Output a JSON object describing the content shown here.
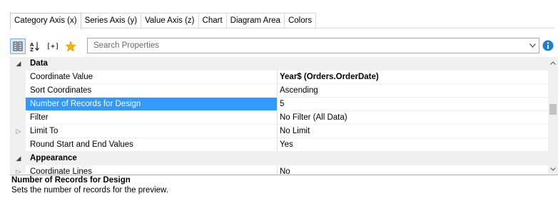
{
  "tabs": [
    {
      "label": "Category Axis (x)",
      "active": true
    },
    {
      "label": "Series Axis (y)",
      "active": false
    },
    {
      "label": "Value Axis (z)",
      "active": false
    },
    {
      "label": "Chart",
      "active": false
    },
    {
      "label": "Diagram Area",
      "active": false
    },
    {
      "label": "Colors",
      "active": false
    }
  ],
  "toolbar": {
    "categorized_icon": "categorized-icon",
    "sort_icon": "sort-az-icon",
    "expand_label": "[+]",
    "favorites_icon": "star-icon",
    "search_placeholder": "Search Properties",
    "info_icon": "info-icon"
  },
  "grid": {
    "rows": [
      {
        "type": "category",
        "name": "Data",
        "expander": "◢"
      },
      {
        "type": "property",
        "name": "Coordinate Value",
        "value": "Year$ (Orders.OrderDate)",
        "bold_value": true
      },
      {
        "type": "property",
        "name": "Sort Coordinates",
        "value": "Ascending"
      },
      {
        "type": "property",
        "name": "Number of Records for Design",
        "value": "5",
        "selected": true
      },
      {
        "type": "property",
        "name": "Filter",
        "value": "No Filter (All Data)"
      },
      {
        "type": "property",
        "name": "Limit To",
        "value": "No Limit",
        "expander": "▷"
      },
      {
        "type": "property",
        "name": "Round Start and End Values",
        "value": "Yes"
      },
      {
        "type": "category",
        "name": "Appearance",
        "expander": "◢"
      },
      {
        "type": "property",
        "name": "Coordinate Lines",
        "value": "No",
        "expander": "▷"
      }
    ]
  },
  "description": {
    "title": "Number of Records for Design",
    "text": "Sets the number of records for the preview."
  },
  "colors": {
    "selection": "#3399ff",
    "category_bg": "#f0f0f0",
    "star": "#f5b400",
    "info": "#1e7fd1"
  }
}
